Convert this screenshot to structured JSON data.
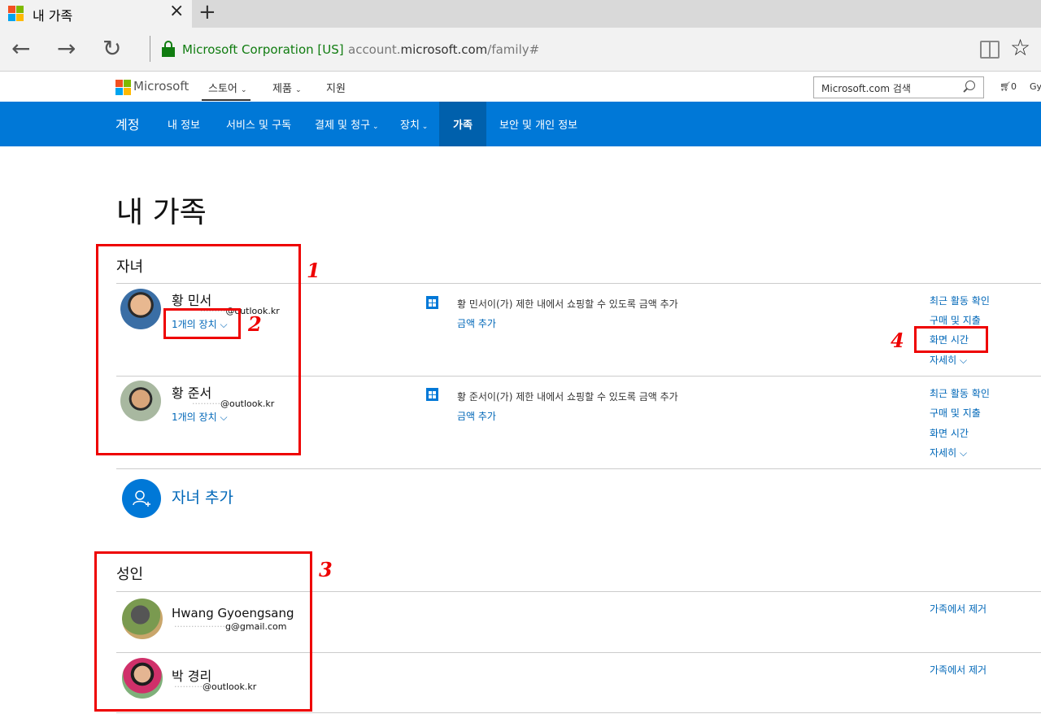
{
  "browser": {
    "tab_title": "내 가족",
    "tab_close": "×",
    "new_tab": "+",
    "back_icon": "←",
    "forward_icon": "→",
    "refresh_icon": "↻",
    "cert_label": "Microsoft Corporation [US]",
    "url_prefix": "account.",
    "url_domain": "microsoft.com",
    "url_path": "/family#",
    "favorite_icon": "☆"
  },
  "site_header": {
    "brand": "Microsoft",
    "nav": [
      {
        "label": "스토어"
      },
      {
        "label": "제품"
      },
      {
        "label": "지원"
      }
    ],
    "search_placeholder": "Microsoft.com 검색",
    "cart_count": "0",
    "user_partial": "Gyo"
  },
  "account_nav": {
    "brand": "계정",
    "items": [
      {
        "label": "내 정보"
      },
      {
        "label": "서비스 및 구독"
      },
      {
        "label": "결제 및 청구"
      },
      {
        "label": "장치"
      },
      {
        "label": "가족"
      },
      {
        "label": "보안 및 개인 정보"
      }
    ]
  },
  "page": {
    "title": "내 가족",
    "children_section": {
      "title": "자녀",
      "members": [
        {
          "name": "황 민서",
          "email_mask": "·········",
          "email_domain": "@outlook.kr",
          "devices": "1개의 장치",
          "store_desc": "황 민서이(가) 제한 내에서 쇼핑할 수 있도록 금액 추가",
          "add_money": "금액 추가",
          "actions": [
            "최근 활동 확인",
            "구매 및 지출",
            "화면 시간",
            "자세히"
          ]
        },
        {
          "name": "황 준서",
          "email_mask": "··········",
          "email_domain": "@outlook.kr",
          "devices": "1개의 장치",
          "store_desc": "황 준서이(가) 제한 내에서 쇼핑할 수 있도록 금액 추가",
          "add_money": "금액 추가",
          "actions": [
            "최근 활동 확인",
            "구매 및 지출",
            "화면 시간",
            "자세히"
          ]
        }
      ],
      "add_child": "자녀 추가"
    },
    "adults_section": {
      "title": "성인",
      "members": [
        {
          "name": "Hwang Gyoengsang",
          "email_mask": "··················",
          "email_domain": "g@gmail.com",
          "action": "가족에서 제거"
        },
        {
          "name": "박 경리",
          "email_mask": "··········",
          "email_domain": "@outlook.kr",
          "action": "가족에서 제거"
        }
      ]
    }
  },
  "annotations": [
    "1",
    "2",
    "3",
    "4"
  ],
  "colors": {
    "accent": "#0078d7",
    "link": "#0067b8",
    "secure": "#107c10",
    "annotation": "#e00000"
  }
}
